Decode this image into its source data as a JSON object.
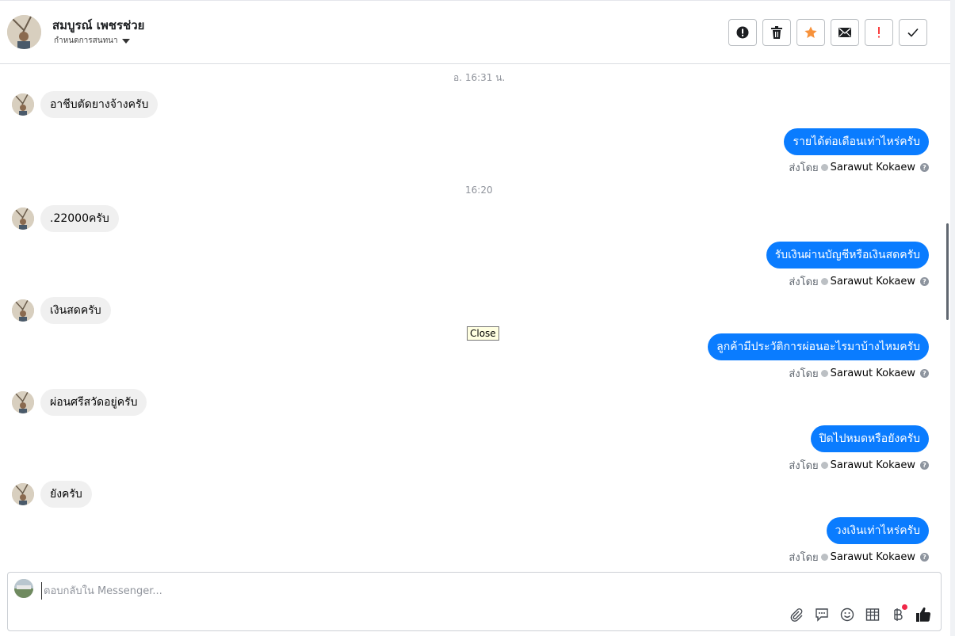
{
  "header": {
    "contact_name": "สมบูรณ์ เพชรช่วย",
    "assign_label": "กำหนดการสนทนา"
  },
  "toolbar": {
    "buttons": [
      {
        "name": "report-spam-button",
        "icon": "exclamation-circle-icon"
      },
      {
        "name": "delete-button",
        "icon": "trash-icon"
      },
      {
        "name": "star-button",
        "icon": "star-icon"
      },
      {
        "name": "mark-unread-button",
        "icon": "envelope-icon"
      },
      {
        "name": "follow-up-button",
        "icon": "exclamation-icon"
      },
      {
        "name": "mark-done-button",
        "icon": "check-icon"
      }
    ],
    "accent_star": "#f7923b",
    "accent_alert": "#fa3e3e"
  },
  "conversation": {
    "timestamp_1": "อ. 16:31 น.",
    "timestamp_2": "16:20",
    "messages": [
      {
        "dir": "in",
        "text": "อาชีบตัดยางจ้างครับ"
      },
      {
        "dir": "out",
        "text": "รายได้ต่อเดือนเท่าไหร่ครับ"
      },
      {
        "dir": "in",
        "text": ".22000ครับ"
      },
      {
        "dir": "out",
        "text": "รับเงินผ่านบัญชีหรือเงินสดครับ"
      },
      {
        "dir": "in",
        "text": "เงินสดครับ"
      },
      {
        "dir": "out",
        "text": "ลูกค้ามีประวัติการผ่อนอะไรมาบ้างไหมครับ"
      },
      {
        "dir": "in",
        "text": "ผ่อนศรีสวัดอยู่ครับ"
      },
      {
        "dir": "out",
        "text": "ปิดไปหมดหรือยังครับ"
      },
      {
        "dir": "in",
        "text": "ยังครับ"
      },
      {
        "dir": "out",
        "text": "วงเงินเท่าไหร่ครับ"
      }
    ],
    "sent_by_label": "ส่งโดย",
    "sender_name": "Sarawut Kokaew",
    "bubble_out_color": "#0a7cff",
    "bubble_in_color": "#f0f0f0"
  },
  "tooltip": {
    "text": "Close"
  },
  "composer": {
    "placeholder": "ตอบกลับใน Messenger...",
    "value": "",
    "icons": [
      "paperclip-icon",
      "quick-reply-icon",
      "emoji-icon",
      "table-icon",
      "baht-payment-icon",
      "like-icon"
    ]
  }
}
